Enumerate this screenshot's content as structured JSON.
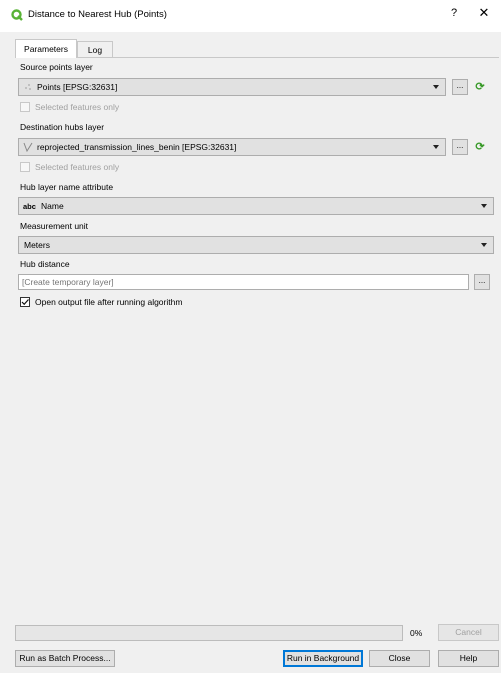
{
  "window": {
    "title": "Distance to Nearest Hub (Points)",
    "help_glyph": "?",
    "close_glyph": "✕"
  },
  "tabs": [
    {
      "label": "Parameters",
      "active": true
    },
    {
      "label": "Log",
      "active": false
    }
  ],
  "params": {
    "source_label": "Source points layer",
    "source_value": "Points [EPSG:32631]",
    "source_selected_only": "Selected features only",
    "dest_label": "Destination hubs layer",
    "dest_value": "reprojected_transmission_lines_benin [EPSG:32631]",
    "dest_selected_only": "Selected features only",
    "hub_name_label": "Hub layer name attribute",
    "hub_name_prefix": "abc",
    "hub_name_value": "Name",
    "unit_label": "Measurement unit",
    "unit_value": "Meters",
    "hub_distance_label": "Hub distance",
    "hub_distance_placeholder": "[Create temporary layer]",
    "open_output_label": "Open output file after running algorithm",
    "open_output_checked": true
  },
  "progress": {
    "value": 0,
    "text": "0%"
  },
  "buttons": {
    "cancel": "Cancel",
    "batch": "Run as Batch Process...",
    "background": "Run in Background",
    "close": "Close",
    "help": "Help",
    "ellipsis": "...",
    "digitize_glyph": "⟳"
  },
  "colors": {
    "qgis_green": "#3a9a2a",
    "default_border": "#0078d7"
  }
}
